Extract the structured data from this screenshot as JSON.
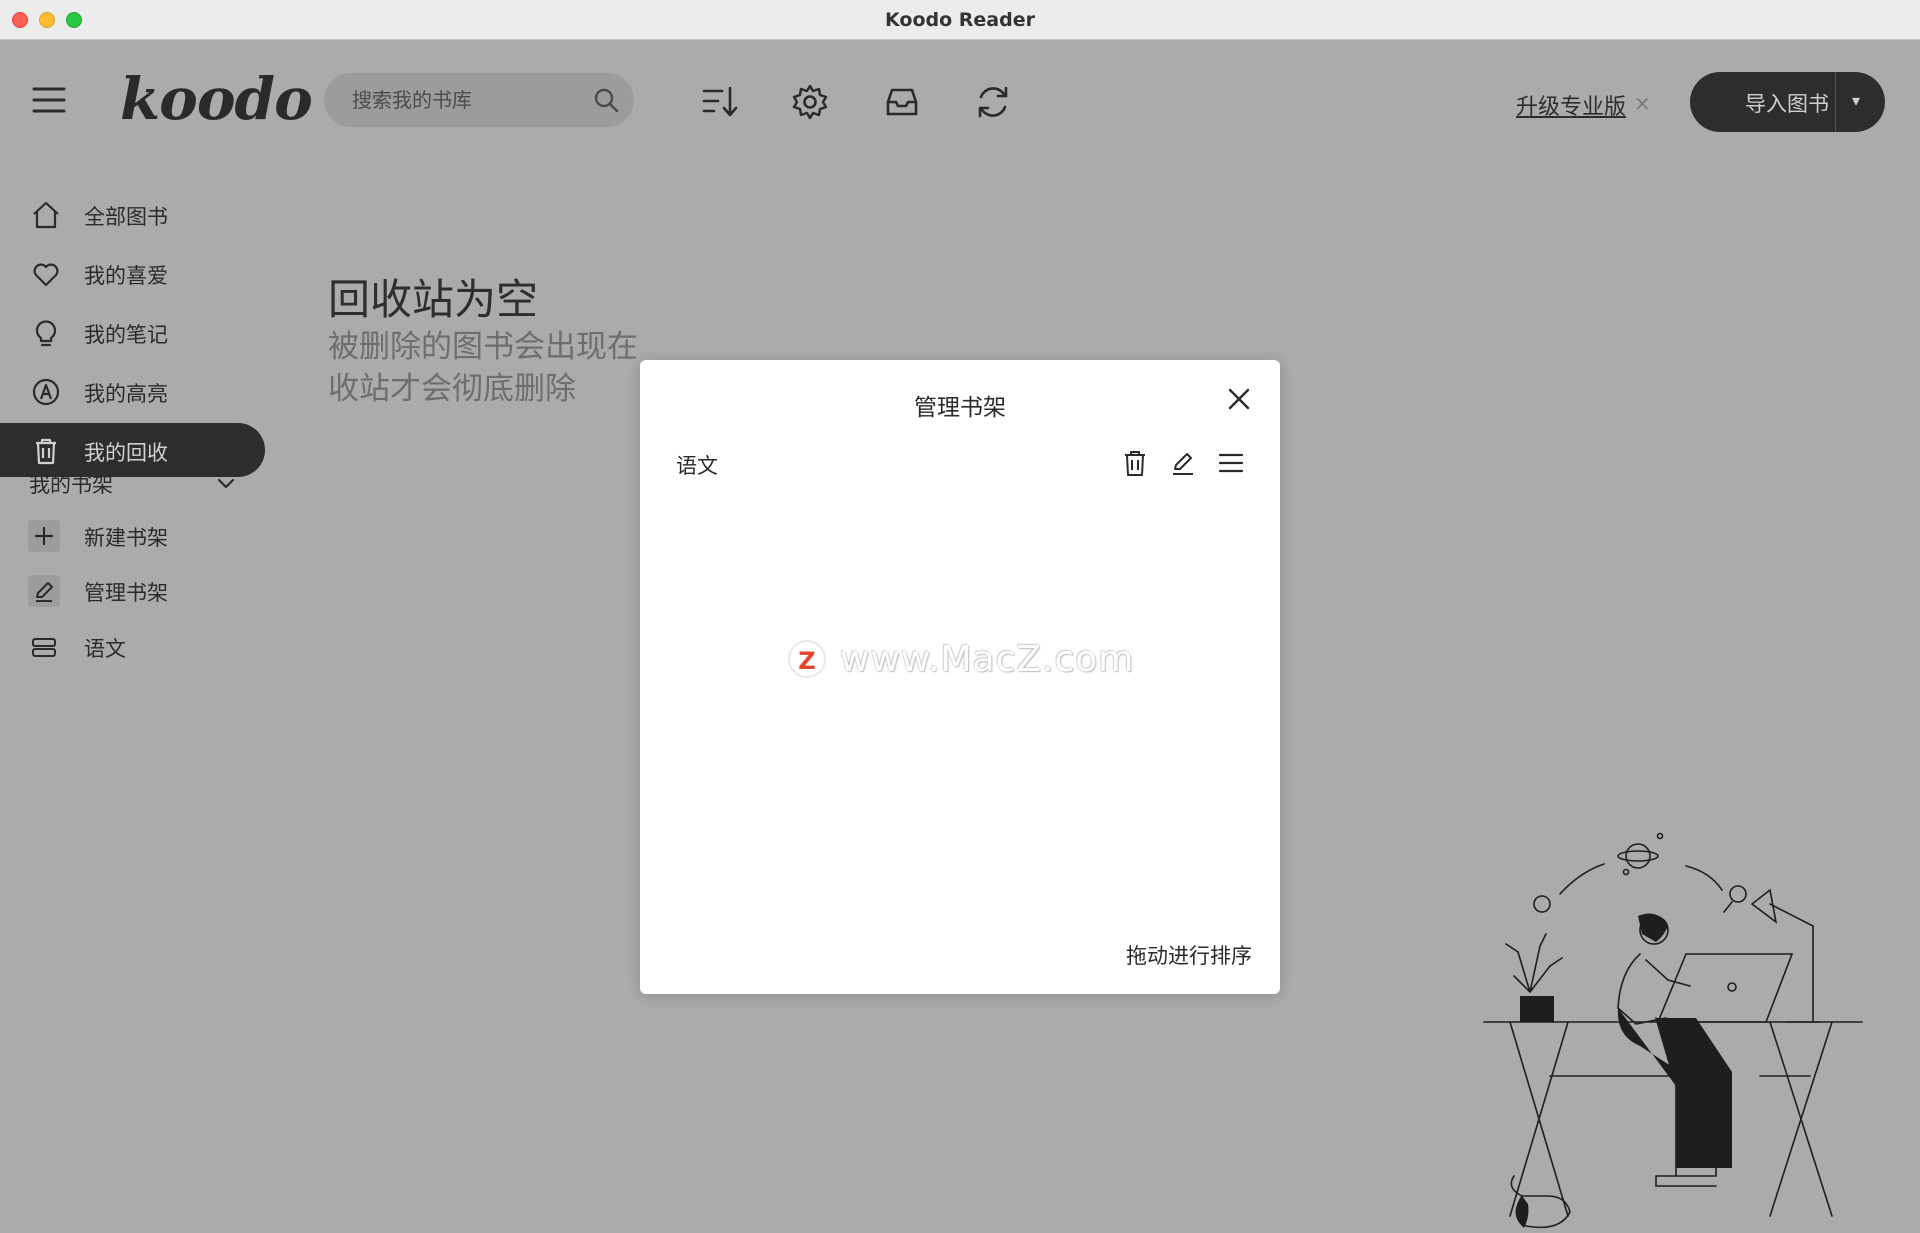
{
  "window": {
    "title": "Koodo Reader"
  },
  "header": {
    "logo": "koodo",
    "search_placeholder": "搜索我的书库",
    "upgrade_label": "升级专业版",
    "upgrade_close": "×",
    "import_label": "导入图书",
    "import_dropdown": "▾",
    "tools": [
      "sort-icon",
      "gear-icon",
      "inbox-icon",
      "sync-icon"
    ]
  },
  "sidebar": {
    "items": [
      {
        "label": "全部图书",
        "icon": "home-icon",
        "active": false
      },
      {
        "label": "我的喜爱",
        "icon": "heart-icon",
        "active": false
      },
      {
        "label": "我的笔记",
        "icon": "lightbulb-icon",
        "active": false
      },
      {
        "label": "我的高亮",
        "icon": "highlight-icon",
        "active": false
      },
      {
        "label": "我的回收",
        "icon": "trash-icon",
        "active": true
      }
    ],
    "shelf_section": {
      "title": "我的书架",
      "items": [
        {
          "label": "新建书架",
          "icon": "plus-icon"
        },
        {
          "label": "管理书架",
          "icon": "pencil-icon"
        },
        {
          "label": "语文",
          "icon": "shelf-icon"
        }
      ]
    }
  },
  "main": {
    "empty_title": "回收站为空",
    "empty_desc_line1": "被删除的图书会出现在",
    "empty_desc_line2": "收站才会彻底删除"
  },
  "modal": {
    "title": "管理书架",
    "shelves": [
      {
        "name": "语文"
      }
    ],
    "hint": "拖动进行排序"
  },
  "watermark": {
    "badge": "Z",
    "text": "www.MacZ.com"
  },
  "colors": {
    "background": "#ababab",
    "dark": "#2d2d2d",
    "modal_bg": "#ffffff",
    "watermark_badge": "#e8452c"
  }
}
